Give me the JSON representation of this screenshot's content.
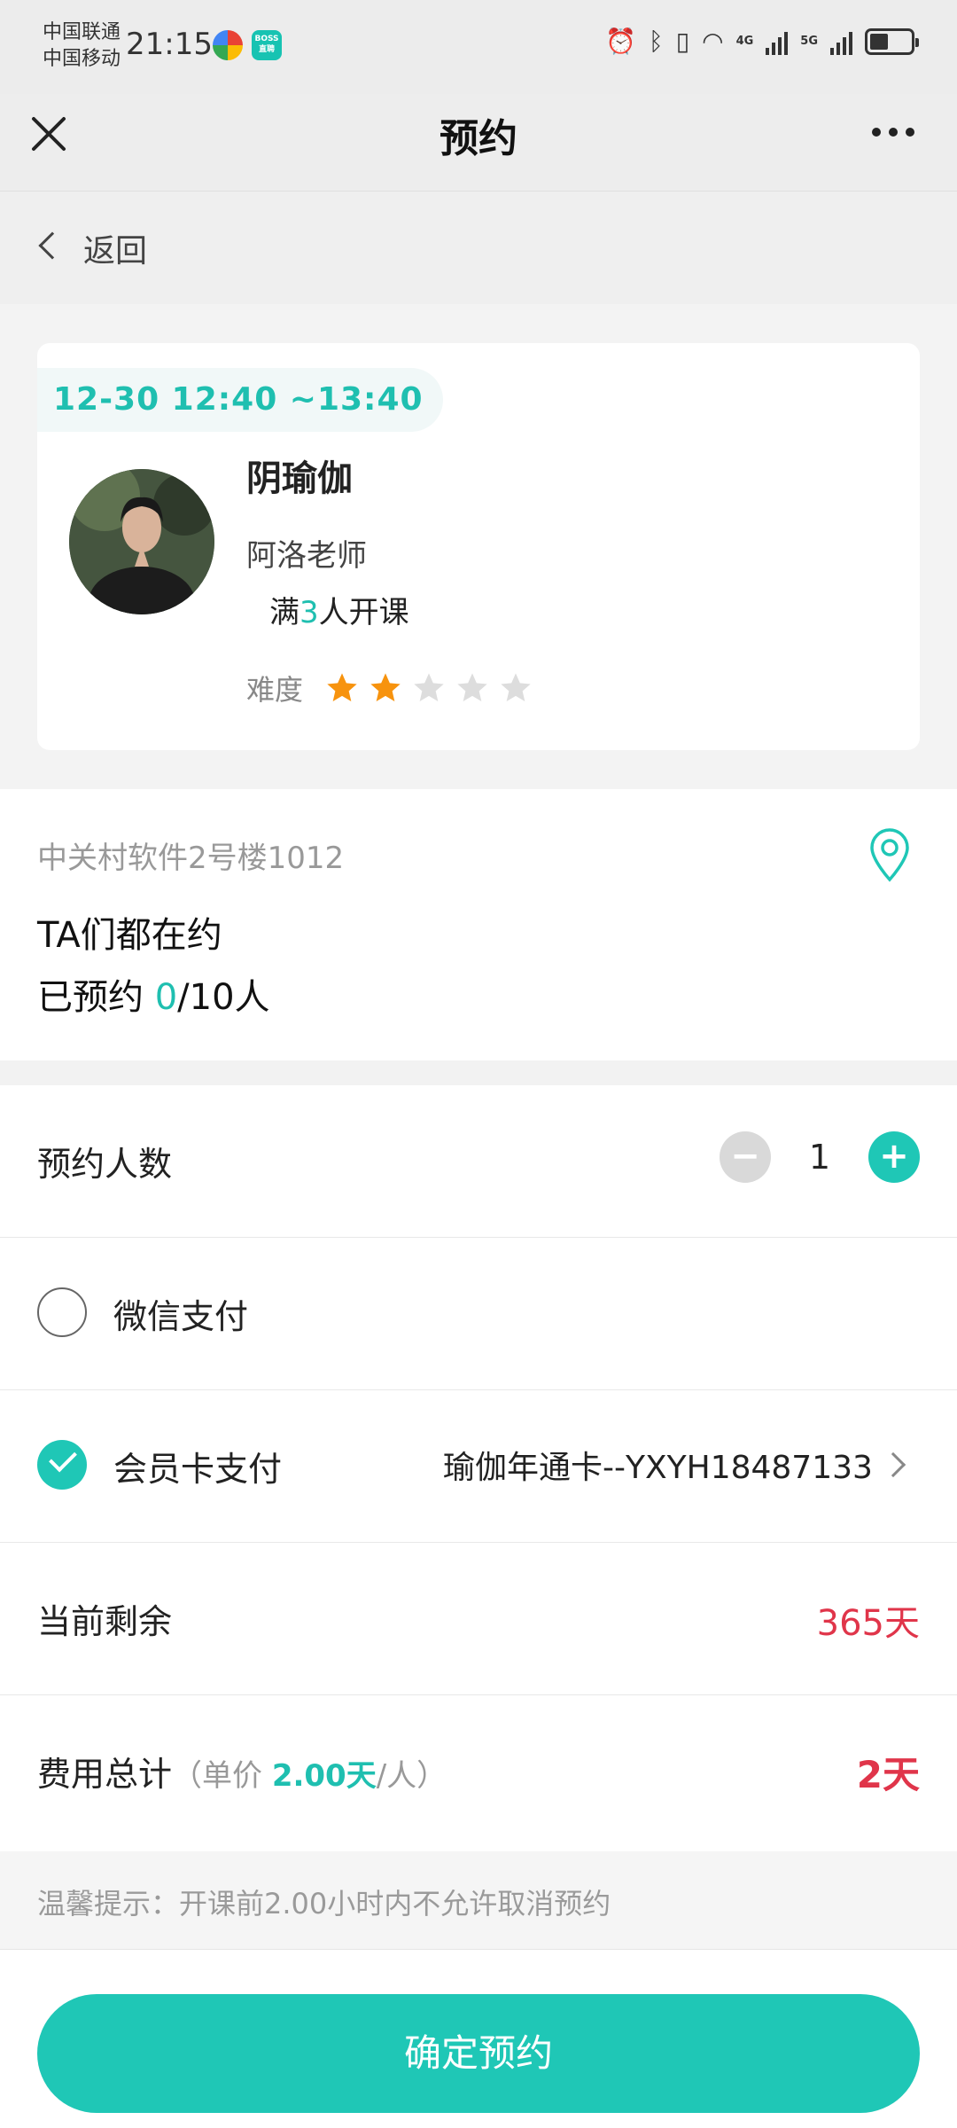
{
  "status_bar": {
    "carrier1": "中国联通",
    "carrier2": "中国移动",
    "time": "21:15",
    "app_badge": "BOSS直聘",
    "net1": "4G",
    "net2": "5G"
  },
  "nav": {
    "title": "预约",
    "back_label": "返回"
  },
  "course": {
    "time": "12-30 12:40 ~13:40",
    "name": "阴瑜伽",
    "teacher": "阿洛老师",
    "min_prefix": "满",
    "min_count": "3",
    "min_suffix": "人开课",
    "difficulty_label": "难度",
    "difficulty_level": 2,
    "difficulty_max": 5
  },
  "location": {
    "address": "中关村软件2号楼1012",
    "participants_title": "TA们都在约",
    "booked_prefix": "已预约 ",
    "booked_count": "0",
    "booked_suffix": "/10人"
  },
  "booking": {
    "count_label": "预约人数",
    "count_value": "1",
    "minus": "−",
    "plus": "+",
    "wechat_label": "微信支付",
    "card_label": "会员卡支付",
    "card_selected": "瑜伽年通卡--YXYH18487133",
    "remaining_label": "当前剩余",
    "remaining_value": "365天",
    "total_label": "费用总计",
    "total_note_prefix": "（单价 ",
    "total_note_price": "2.00天",
    "total_note_suffix": "/人）",
    "total_value": "2天"
  },
  "tip": "温馨提示：开课前2.00小时内不允许取消预约",
  "confirm_label": "确定预约",
  "colors": {
    "accent": "#1fc7b6",
    "price_red": "#e0354a",
    "star_on": "#f7930e",
    "star_off": "#dddddd"
  }
}
